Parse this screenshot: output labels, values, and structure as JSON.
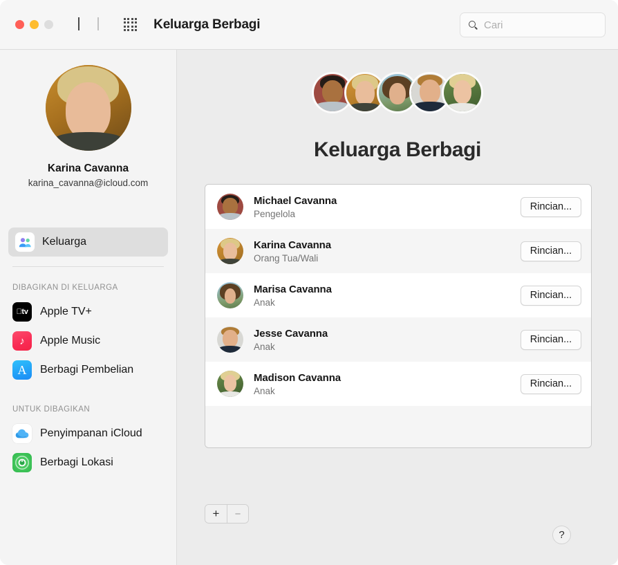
{
  "window": {
    "title": "Keluarga Berbagi",
    "traffic_lights": [
      "close",
      "minimize",
      "zoom"
    ],
    "nav_back": "back-arrow",
    "nav_forward": "forward-arrow",
    "grid_button": "show-all-icon"
  },
  "search": {
    "placeholder": "Cari",
    "value": "",
    "icon": "search-icon"
  },
  "sidebar": {
    "account": {
      "name": "Karina Cavanna",
      "email": "karina_cavanna@icloud.com",
      "avatar": "avatar"
    },
    "primary_item": {
      "label": "Keluarga",
      "icon": "family-group-icon",
      "selected": true
    },
    "sections": [
      {
        "title": "DIBAGIKAN DI KELUARGA",
        "items": [
          {
            "label": "Apple TV+",
            "icon": "apple-tv-icon"
          },
          {
            "label": "Apple Music",
            "icon": "apple-music-icon"
          },
          {
            "label": "Berbagi Pembelian",
            "icon": "app-store-icon"
          }
        ]
      },
      {
        "title": "UNTUK DIBAGIKAN",
        "items": [
          {
            "label": "Penyimpanan iCloud",
            "icon": "icloud-icon"
          },
          {
            "label": "Berbagi Lokasi",
            "icon": "find-my-icon"
          }
        ]
      }
    ]
  },
  "main": {
    "heading": "Keluarga Berbagi",
    "avatar_stack": [
      {
        "name": "Michael Cavanna"
      },
      {
        "name": "Karina Cavanna"
      },
      {
        "name": "Marisa Cavanna"
      },
      {
        "name": "Jesse Cavanna"
      },
      {
        "name": "Madison Cavanna"
      }
    ],
    "members": [
      {
        "name": "Michael Cavanna",
        "role": "Pengelola",
        "button": "Rincian..."
      },
      {
        "name": "Karina Cavanna",
        "role": "Orang Tua/Wali",
        "button": "Rincian..."
      },
      {
        "name": "Marisa Cavanna",
        "role": "Anak",
        "button": "Rincian..."
      },
      {
        "name": "Jesse Cavanna",
        "role": "Anak",
        "button": "Rincian..."
      },
      {
        "name": "Madison Cavanna",
        "role": "Anak",
        "button": "Rincian..."
      }
    ],
    "add_button": "+",
    "remove_button": "−",
    "help_button": "?"
  },
  "colors": {
    "window_bg": "#ececec",
    "sidebar_bg": "#f4f4f4",
    "titlebar_bg": "#f6f6f6",
    "selected_row": "#dedede",
    "traffic_red": "#ff5f57",
    "traffic_yellow": "#febc2e",
    "traffic_gray": "#dddddd",
    "apple_music": "#f92b54",
    "app_store": "#1a8bf5",
    "find_my": "#2fb84c"
  }
}
